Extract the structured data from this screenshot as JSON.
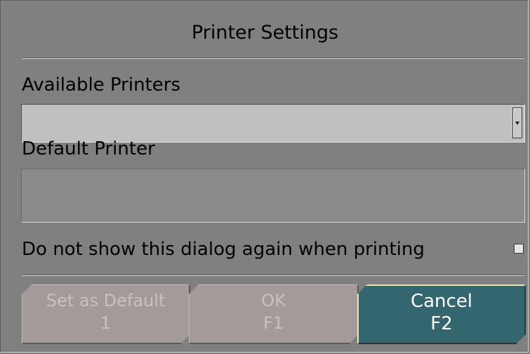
{
  "dialog": {
    "title": "Printer Settings",
    "available_printers_label": "Available Printers",
    "available_printers_value": "",
    "default_printer_label": "Default Printer",
    "default_printer_value": "",
    "dont_show_label": "Do not show this dialog again when printing",
    "dont_show_checked": false
  },
  "buttons": {
    "set_default": {
      "label": "Set as Default",
      "key": "1",
      "enabled": false
    },
    "ok": {
      "label": "OK",
      "key": "F1",
      "enabled": false
    },
    "cancel": {
      "label": "Cancel",
      "key": "F2",
      "enabled": true
    }
  },
  "colors": {
    "background": "#808080",
    "cancel_button": "#33666e",
    "disabled_button": "#a49a9a"
  }
}
